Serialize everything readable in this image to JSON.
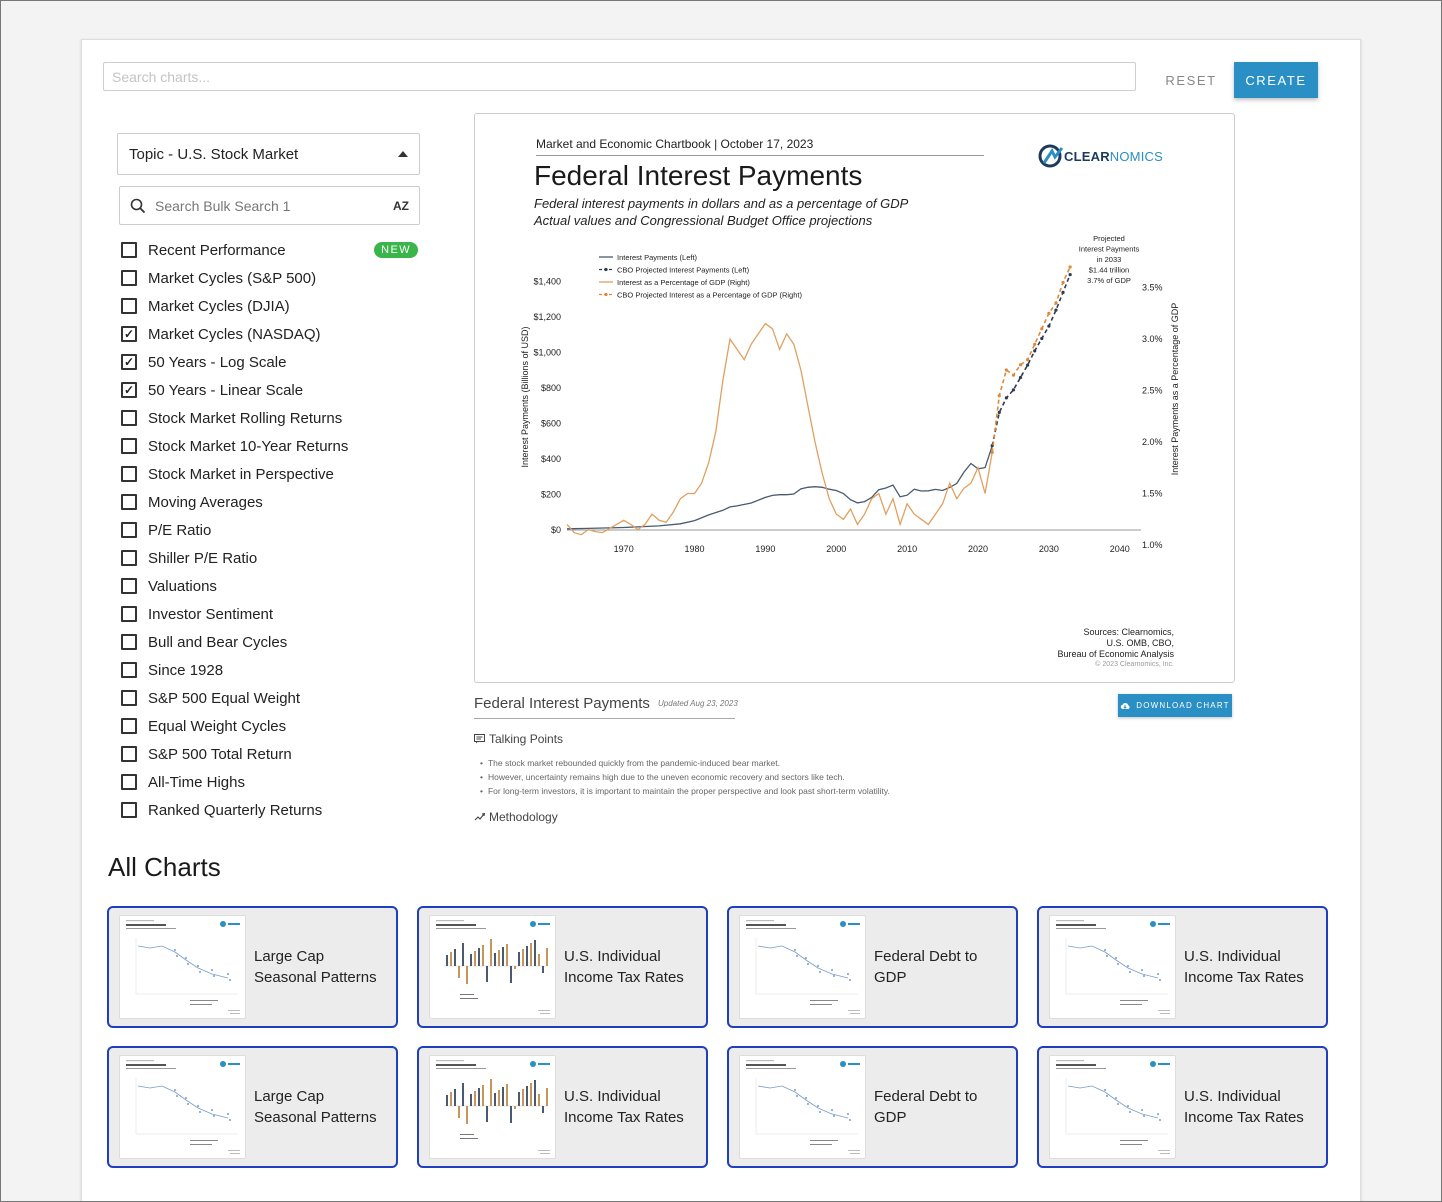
{
  "toolbar": {
    "search_placeholder": "Search charts...",
    "reset_label": "RESET",
    "create_label": "CREATE"
  },
  "sidebar": {
    "topic_label": "Topic - U.S. Stock Market",
    "bulk_search_label": "Search Bulk Search 1",
    "az_label": "AZ",
    "new_badge": "NEW",
    "items": [
      {
        "label": "Recent Performance",
        "checked": false
      },
      {
        "label": "Market Cycles (S&P 500)",
        "checked": false
      },
      {
        "label": "Market Cycles (DJIA)",
        "checked": false
      },
      {
        "label": "Market Cycles (NASDAQ)",
        "checked": true
      },
      {
        "label": "50 Years - Log Scale",
        "checked": true
      },
      {
        "label": "50 Years - Linear Scale",
        "checked": true
      },
      {
        "label": "Stock Market Rolling Returns",
        "checked": false
      },
      {
        "label": "Stock Market 10-Year Returns",
        "checked": false
      },
      {
        "label": "Stock Market in Perspective",
        "checked": false
      },
      {
        "label": "Moving Averages",
        "checked": false
      },
      {
        "label": "P/E Ratio",
        "checked": false
      },
      {
        "label": "Shiller P/E Ratio",
        "checked": false
      },
      {
        "label": "Valuations",
        "checked": false
      },
      {
        "label": "Investor Sentiment",
        "checked": false
      },
      {
        "label": "Bull and Bear Cycles",
        "checked": false
      },
      {
        "label": "Since 1928",
        "checked": false
      },
      {
        "label": "S&P 500 Equal Weight",
        "checked": false
      },
      {
        "label": "Equal Weight Cycles",
        "checked": false
      },
      {
        "label": "S&P 500 Total Return",
        "checked": false
      },
      {
        "label": "All-Time Highs",
        "checked": false
      },
      {
        "label": "Ranked Quarterly Returns",
        "checked": false
      }
    ]
  },
  "preview": {
    "header": "Market and Economic Chartbook | October 17, 2023",
    "title": "Federal Interest Payments",
    "subtitle1": "Federal interest payments in dollars and as a percentage of GDP",
    "subtitle2": "Actual values and Congressional Budget Office projections",
    "logo_clear": "CLEAR",
    "logo_nomics": "NOMICS",
    "source1": "Sources: Clearnomics,",
    "source2": "U.S. OMB, CBO,",
    "source3": "Bureau of Economic Analysis",
    "copyright": "© 2023 Clearnomics, Inc."
  },
  "chart_data": {
    "type": "line",
    "ylabel": "Interest Payments (Billions of USD)",
    "y2label": "Interest Payments as a Percentage of GDP",
    "ylim": [
      0,
      1500
    ],
    "y2lim": [
      1.0,
      3.7
    ],
    "xlim": [
      1962,
      2043
    ],
    "xticks": [
      1970,
      1980,
      1990,
      2000,
      2010,
      2020,
      2030,
      2040
    ],
    "yticks": [
      "$0",
      "$200",
      "$400",
      "$600",
      "$800",
      "$1,000",
      "$1,200",
      "$1,400"
    ],
    "y2ticks": [
      "1.0%",
      "1.5%",
      "2.0%",
      "2.5%",
      "3.0%",
      "3.5%"
    ],
    "legend": [
      {
        "name": "Interest Payments (Left)",
        "color": "#4a5a70",
        "dash": false
      },
      {
        "name": "CBO Projected Interest Payments (Left)",
        "color": "#2e3a50",
        "dash": true
      },
      {
        "name": "Interest as a Percentage of GDP (Right)",
        "color": "#e0a060",
        "dash": false
      },
      {
        "name": "CBO Projected Interest as a Percentage of GDP (Right)",
        "color": "#e0883a",
        "dash": true
      }
    ],
    "annotation": [
      "Projected",
      "Interest Payments",
      "in 2033",
      "$1.44 trillion",
      "3.7% of GDP"
    ],
    "series": [
      {
        "name": "Interest Payments (Left)",
        "axis": "left",
        "x": [
          1962,
          1965,
          1970,
          1975,
          1978,
          1980,
          1982,
          1984,
          1985,
          1986,
          1988,
          1990,
          1991,
          1992,
          1993,
          1994,
          1995,
          1996,
          1997,
          1998,
          1999,
          2000,
          2001,
          2002,
          2003,
          2004,
          2005,
          2006,
          2007,
          2008,
          2009,
          2010,
          2011,
          2012,
          2013,
          2014,
          2015,
          2016,
          2017,
          2018,
          2019,
          2020,
          2021,
          2022
        ],
        "values": [
          7,
          9,
          14,
          23,
          35,
          53,
          85,
          111,
          130,
          136,
          152,
          184,
          195,
          199,
          199,
          203,
          232,
          241,
          244,
          241,
          230,
          223,
          206,
          171,
          153,
          160,
          184,
          227,
          237,
          253,
          187,
          196,
          230,
          220,
          221,
          229,
          223,
          240,
          263,
          325,
          375,
          345,
          352,
          475
        ]
      },
      {
        "name": "CBO Projected Interest Payments (Left)",
        "axis": "left",
        "x": [
          2022,
          2023,
          2024,
          2025,
          2026,
          2027,
          2028,
          2029,
          2030,
          2031,
          2032,
          2033
        ],
        "values": [
          475,
          663,
          745,
          790,
          860,
          930,
          1010,
          1080,
          1150,
          1240,
          1340,
          1440
        ]
      },
      {
        "name": "Interest as a Percentage of GDP (Right)",
        "axis": "right",
        "x": [
          1962,
          1963,
          1964,
          1965,
          1966,
          1967,
          1968,
          1969,
          1970,
          1971,
          1972,
          1973,
          1974,
          1975,
          1976,
          1977,
          1978,
          1979,
          1980,
          1981,
          1982,
          1983,
          1984,
          1985,
          1986,
          1987,
          1988,
          1989,
          1990,
          1991,
          1992,
          1993,
          1994,
          1995,
          1996,
          1997,
          1998,
          1999,
          2000,
          2001,
          2002,
          2003,
          2004,
          2005,
          2006,
          2007,
          2008,
          2009,
          2010,
          2011,
          2012,
          2013,
          2014,
          2015,
          2016,
          2017,
          2018,
          2019,
          2020,
          2021,
          2022
        ],
        "values": [
          1.2,
          1.12,
          1.1,
          1.15,
          1.13,
          1.12,
          1.16,
          1.2,
          1.24,
          1.2,
          1.15,
          1.2,
          1.3,
          1.24,
          1.22,
          1.32,
          1.45,
          1.5,
          1.5,
          1.6,
          1.8,
          2.1,
          2.6,
          3.0,
          2.9,
          2.8,
          2.95,
          3.05,
          3.15,
          3.1,
          2.9,
          3.05,
          2.95,
          2.7,
          2.35,
          2.0,
          1.7,
          1.45,
          1.3,
          1.25,
          1.35,
          1.2,
          1.3,
          1.45,
          1.5,
          1.3,
          1.45,
          1.2,
          1.4,
          1.3,
          1.25,
          1.2,
          1.3,
          1.4,
          1.6,
          1.45,
          1.55,
          1.6,
          1.75,
          1.5,
          1.9
        ]
      },
      {
        "name": "CBO Projected Interest as a Percentage of GDP (Right)",
        "axis": "right",
        "x": [
          2022,
          2023,
          2024,
          2025,
          2026,
          2027,
          2028,
          2029,
          2030,
          2031,
          2032,
          2033
        ],
        "values": [
          1.9,
          2.45,
          2.7,
          2.65,
          2.75,
          2.8,
          2.95,
          3.1,
          3.25,
          3.35,
          3.55,
          3.7
        ]
      }
    ]
  },
  "info": {
    "title": "Federal Interest Payments",
    "updated": "Updated Aug 23, 2023",
    "download_label": "DOWNLOAD CHART",
    "talking_points_label": "Talking Points",
    "points": [
      "The stock market rebounded quickly from the pandemic-induced bear market.",
      "However, uncertainty remains high due to the uneven economic recovery and sectors like tech.",
      "For long-term investors, it is important to maintain the proper perspective and look past short-term volatility."
    ],
    "methodology_label": "Methodology"
  },
  "gallery": {
    "heading": "All Charts",
    "cards": [
      {
        "line1": "Large Cap",
        "line2": "Seasonal Patterns",
        "thumb": "dot-plot"
      },
      {
        "line1": "U.S. Individual",
        "line2": "Income Tax Rates",
        "thumb": "bar-chart"
      },
      {
        "line1": "Federal Debt to",
        "line2": "GDP",
        "thumb": "dot-plot"
      },
      {
        "line1": "U.S. Individual",
        "line2": "Income Tax Rates",
        "thumb": "dot-plot"
      },
      {
        "line1": "Large Cap",
        "line2": "Seasonal Patterns",
        "thumb": "dot-plot"
      },
      {
        "line1": "U.S. Individual",
        "line2": "Income Tax Rates",
        "thumb": "bar-chart"
      },
      {
        "line1": "Federal Debt to",
        "line2": "GDP",
        "thumb": "dot-plot"
      },
      {
        "line1": "U.S. Individual",
        "line2": "Income Tax Rates",
        "thumb": "dot-plot"
      }
    ]
  }
}
